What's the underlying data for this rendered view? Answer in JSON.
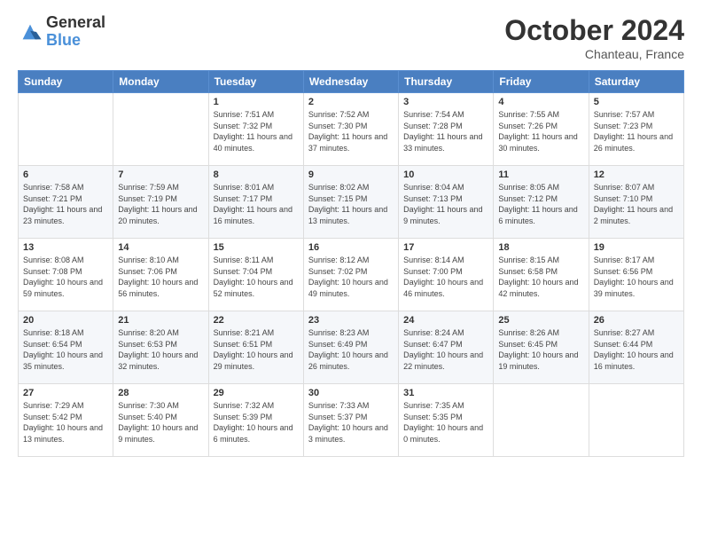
{
  "header": {
    "logo_general": "General",
    "logo_blue": "Blue",
    "month_title": "October 2024",
    "location": "Chanteau, France"
  },
  "days_of_week": [
    "Sunday",
    "Monday",
    "Tuesday",
    "Wednesday",
    "Thursday",
    "Friday",
    "Saturday"
  ],
  "weeks": [
    [
      {
        "day": "",
        "info": ""
      },
      {
        "day": "",
        "info": ""
      },
      {
        "day": "1",
        "info": "Sunrise: 7:51 AM\nSunset: 7:32 PM\nDaylight: 11 hours and 40 minutes."
      },
      {
        "day": "2",
        "info": "Sunrise: 7:52 AM\nSunset: 7:30 PM\nDaylight: 11 hours and 37 minutes."
      },
      {
        "day": "3",
        "info": "Sunrise: 7:54 AM\nSunset: 7:28 PM\nDaylight: 11 hours and 33 minutes."
      },
      {
        "day": "4",
        "info": "Sunrise: 7:55 AM\nSunset: 7:26 PM\nDaylight: 11 hours and 30 minutes."
      },
      {
        "day": "5",
        "info": "Sunrise: 7:57 AM\nSunset: 7:23 PM\nDaylight: 11 hours and 26 minutes."
      }
    ],
    [
      {
        "day": "6",
        "info": "Sunrise: 7:58 AM\nSunset: 7:21 PM\nDaylight: 11 hours and 23 minutes."
      },
      {
        "day": "7",
        "info": "Sunrise: 7:59 AM\nSunset: 7:19 PM\nDaylight: 11 hours and 20 minutes."
      },
      {
        "day": "8",
        "info": "Sunrise: 8:01 AM\nSunset: 7:17 PM\nDaylight: 11 hours and 16 minutes."
      },
      {
        "day": "9",
        "info": "Sunrise: 8:02 AM\nSunset: 7:15 PM\nDaylight: 11 hours and 13 minutes."
      },
      {
        "day": "10",
        "info": "Sunrise: 8:04 AM\nSunset: 7:13 PM\nDaylight: 11 hours and 9 minutes."
      },
      {
        "day": "11",
        "info": "Sunrise: 8:05 AM\nSunset: 7:12 PM\nDaylight: 11 hours and 6 minutes."
      },
      {
        "day": "12",
        "info": "Sunrise: 8:07 AM\nSunset: 7:10 PM\nDaylight: 11 hours and 2 minutes."
      }
    ],
    [
      {
        "day": "13",
        "info": "Sunrise: 8:08 AM\nSunset: 7:08 PM\nDaylight: 10 hours and 59 minutes."
      },
      {
        "day": "14",
        "info": "Sunrise: 8:10 AM\nSunset: 7:06 PM\nDaylight: 10 hours and 56 minutes."
      },
      {
        "day": "15",
        "info": "Sunrise: 8:11 AM\nSunset: 7:04 PM\nDaylight: 10 hours and 52 minutes."
      },
      {
        "day": "16",
        "info": "Sunrise: 8:12 AM\nSunset: 7:02 PM\nDaylight: 10 hours and 49 minutes."
      },
      {
        "day": "17",
        "info": "Sunrise: 8:14 AM\nSunset: 7:00 PM\nDaylight: 10 hours and 46 minutes."
      },
      {
        "day": "18",
        "info": "Sunrise: 8:15 AM\nSunset: 6:58 PM\nDaylight: 10 hours and 42 minutes."
      },
      {
        "day": "19",
        "info": "Sunrise: 8:17 AM\nSunset: 6:56 PM\nDaylight: 10 hours and 39 minutes."
      }
    ],
    [
      {
        "day": "20",
        "info": "Sunrise: 8:18 AM\nSunset: 6:54 PM\nDaylight: 10 hours and 35 minutes."
      },
      {
        "day": "21",
        "info": "Sunrise: 8:20 AM\nSunset: 6:53 PM\nDaylight: 10 hours and 32 minutes."
      },
      {
        "day": "22",
        "info": "Sunrise: 8:21 AM\nSunset: 6:51 PM\nDaylight: 10 hours and 29 minutes."
      },
      {
        "day": "23",
        "info": "Sunrise: 8:23 AM\nSunset: 6:49 PM\nDaylight: 10 hours and 26 minutes."
      },
      {
        "day": "24",
        "info": "Sunrise: 8:24 AM\nSunset: 6:47 PM\nDaylight: 10 hours and 22 minutes."
      },
      {
        "day": "25",
        "info": "Sunrise: 8:26 AM\nSunset: 6:45 PM\nDaylight: 10 hours and 19 minutes."
      },
      {
        "day": "26",
        "info": "Sunrise: 8:27 AM\nSunset: 6:44 PM\nDaylight: 10 hours and 16 minutes."
      }
    ],
    [
      {
        "day": "27",
        "info": "Sunrise: 7:29 AM\nSunset: 5:42 PM\nDaylight: 10 hours and 13 minutes."
      },
      {
        "day": "28",
        "info": "Sunrise: 7:30 AM\nSunset: 5:40 PM\nDaylight: 10 hours and 9 minutes."
      },
      {
        "day": "29",
        "info": "Sunrise: 7:32 AM\nSunset: 5:39 PM\nDaylight: 10 hours and 6 minutes."
      },
      {
        "day": "30",
        "info": "Sunrise: 7:33 AM\nSunset: 5:37 PM\nDaylight: 10 hours and 3 minutes."
      },
      {
        "day": "31",
        "info": "Sunrise: 7:35 AM\nSunset: 5:35 PM\nDaylight: 10 hours and 0 minutes."
      },
      {
        "day": "",
        "info": ""
      },
      {
        "day": "",
        "info": ""
      }
    ]
  ]
}
